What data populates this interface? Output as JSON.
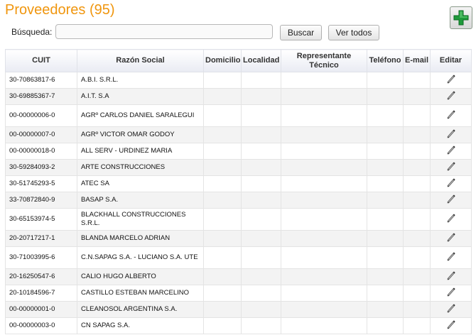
{
  "header": {
    "title": "Proveedores (95)"
  },
  "search": {
    "label": "Búsqueda:",
    "value": "",
    "placeholder": "",
    "search_button": "Buscar",
    "all_button": "Ver todos"
  },
  "add_button": {
    "icon": "plus-icon",
    "color": "#1e9a3a"
  },
  "table": {
    "columns": [
      "CUIT",
      "Razón Social",
      "Domicilio",
      "Localidad",
      "Representante Técnico",
      "Teléfono",
      "E-mail",
      "Editar"
    ],
    "rows": [
      {
        "cuit": "30-70863817-6",
        "razon": "A.B.I. S.R.L."
      },
      {
        "cuit": "30-69885367-7",
        "razon": "A.I.T. S.A"
      },
      {
        "cuit": "00-00000006-0",
        "razon": "AGRº CARLOS DANIEL SARALEGUI"
      },
      {
        "cuit": "00-00000007-0",
        "razon": "AGRº VICTOR OMAR GODOY"
      },
      {
        "cuit": "00-00000018-0",
        "razon": "ALL SERV - URDINEZ MARIA"
      },
      {
        "cuit": "30-59284093-2",
        "razon": "ARTE CONSTRUCCIONES"
      },
      {
        "cuit": "30-51745293-5",
        "razon": "ATEC SA"
      },
      {
        "cuit": "33-70872840-9",
        "razon": "BASAP S.A."
      },
      {
        "cuit": "30-65153974-5",
        "razon": "BLACKHALL CONSTRUCCIONES S.R.L."
      },
      {
        "cuit": "20-20717217-1",
        "razon": "BLANDA MARCELO ADRIAN"
      },
      {
        "cuit": "30-71003995-6",
        "razon": "C.N.SAPAG S.A. - LUCIANO S.A. UTE"
      },
      {
        "cuit": "20-16250547-6",
        "razon": "CALIO HUGO ALBERTO"
      },
      {
        "cuit": "20-10184596-7",
        "razon": "CASTILLO ESTEBAN MARCELINO"
      },
      {
        "cuit": "00-00000001-0",
        "razon": "CLEANOSOL ARGENTINA S.A."
      },
      {
        "cuit": "00-00000003-0",
        "razon": "CN SAPAG S.A."
      }
    ],
    "edit_icon": "pencil-icon"
  }
}
